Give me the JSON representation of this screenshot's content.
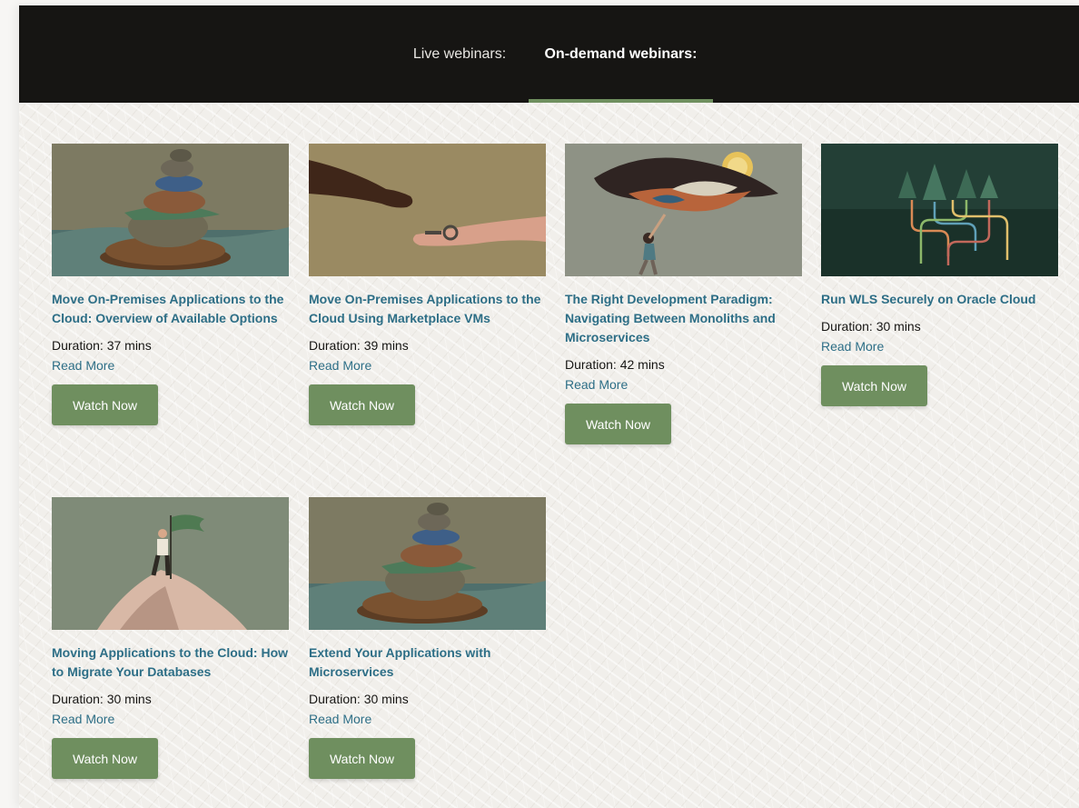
{
  "tabs": {
    "live": "Live webinars:",
    "ondemand": "On-demand webinars:"
  },
  "accent_color": "#6f8f5f",
  "link_color": "#2d6e86",
  "cards": [
    {
      "title": "Move On-Premises Applications to the Cloud: Overview of Available Options",
      "duration": "Duration: 37 mins",
      "read_more": "Read More",
      "watch": "Watch Now",
      "image": "stacked-stones-image"
    },
    {
      "title": "Move On-Premises Applications to the Cloud Using Marketplace VMs",
      "duration": "Duration: 39 mins",
      "read_more": "Read More",
      "watch": "Watch Now",
      "image": "hands-key-image"
    },
    {
      "title": "The Right Development Paradigm: Navigating Between Monoliths and Microservices",
      "duration": "Duration: 42 mins",
      "read_more": "Read More",
      "watch": "Watch Now",
      "image": "floating-island-image"
    },
    {
      "title": "Run WLS Securely on Oracle Cloud",
      "duration": "Duration: 30 mins",
      "read_more": "Read More",
      "watch": "Watch Now",
      "image": "forest-roots-image"
    },
    {
      "title": "Moving Applications to the Cloud: How to Migrate Your Databases",
      "duration": "Duration: 30 mins",
      "read_more": "Read More",
      "watch": "Watch Now",
      "image": "flag-summit-image"
    },
    {
      "title": "Extend Your Applications with Microservices",
      "duration": "Duration: 30 mins",
      "read_more": "Read More",
      "watch": "Watch Now",
      "image": "stacked-stones-image"
    }
  ]
}
